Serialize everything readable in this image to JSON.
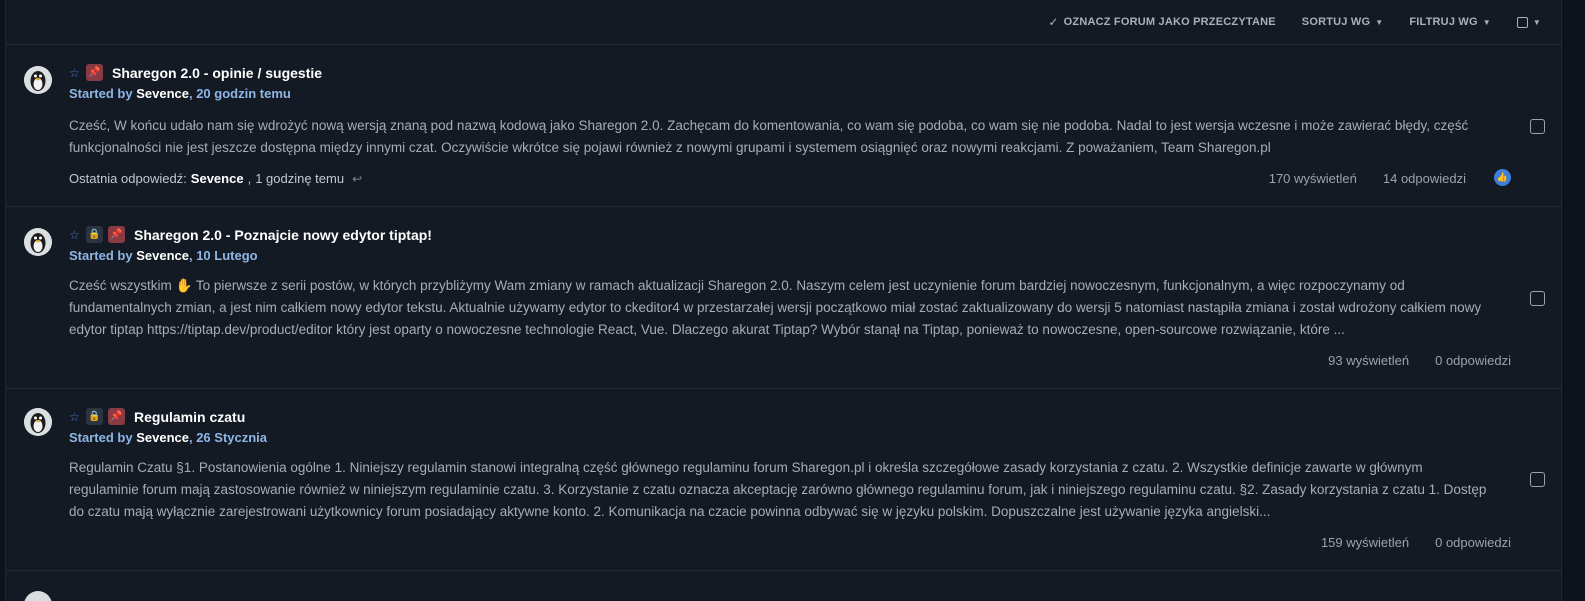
{
  "toolbar": {
    "mark_read": "OZNACZ FORUM JAKO PRZECZYTANE",
    "sort": "SORTUJ WG",
    "filter": "FILTRUJ WG"
  },
  "topics": [
    {
      "title": "Sharegon 2.0 - opinie / sugestie",
      "started_by": "Started by",
      "author": "Sevence",
      "date": "20 godzin temu",
      "snippet": "Cześć, W końcu udało nam się wdrożyć nową wersją znaną pod nazwą kodową jako Sharegon 2.0. Zachęcam do komentowania, co wam się podoba, co wam się nie podoba. Nadal to jest wersja wczesne i może zawierać błędy, część funkcjonalności nie jest jeszcze dostępna między innymi czat. Oczywiście wkrótce się pojawi również z nowymi grupami i systemem osiągnięć oraz nowymi reakcjami. Z poważaniem, Team Sharegon.pl",
      "last_reply_label": "Ostatnia odpowiedź:",
      "last_reply_author": "Sevence",
      "last_reply_time": "1 godzinę temu",
      "views": "170 wyświetleń",
      "replies": "14 odpowiedzi",
      "locked": false,
      "pinned": true
    },
    {
      "title": "Sharegon 2.0 - Poznajcie nowy edytor tiptap!",
      "started_by": "Started by",
      "author": "Sevence",
      "date": "10 Lutego",
      "snippet_pre": "Cześć wszystkim",
      "snippet_emoji": "✋",
      "snippet": "To pierwsze z serii postów, w których przybliżymy Wam zmiany w ramach aktualizacji Sharegon 2.0. Naszym celem jest uczynienie forum bardziej nowoczesnym, funkcjonalnym, a więc rozpoczynamy od fundamentalnych zmian, a jest nim całkiem nowy edytor tekstu. Aktualnie używamy edytor to ckeditor4 w przestarzałej wersji początkowo miał zostać zaktualizowany do wersji 5 natomiast nastąpiła zmiana i został wdrożony całkiem nowy edytor tiptap https://tiptap.dev/product/editor który jest oparty o nowoczesne technologie React, Vue. Dlaczego akurat Tiptap? Wybór stanął na Tiptap, ponieważ to nowoczesne, open-sourcowe rozwiązanie, które ...",
      "views": "93 wyświetleń",
      "replies": "0 odpowiedzi",
      "locked": true,
      "pinned": true
    },
    {
      "title": "Regulamin czatu",
      "started_by": "Started by",
      "author": "Sevence",
      "date": "26 Stycznia",
      "snippet": "Regulamin Czatu §1. Postanowienia ogólne 1. Niniejszy regulamin stanowi integralną część głównego regulaminu forum Sharegon.pl i określa szczegółowe zasady korzystania z czatu. 2. Wszystkie definicje zawarte w głównym regulaminie forum mają zastosowanie również w niniejszym regulaminie czatu. 3. Korzystanie z czatu oznacza akceptację zarówno głównego regulaminu forum, jak i niniejszego regulaminu czatu. §2. Zasady korzystania z czatu 1. Dostęp do czatu mają wyłącznie zarejestrowani użytkownicy forum posiadający aktywne konto. 2. Komunikacja na czacie powinna odbywać się w języku polskim. Dopuszczalne jest używanie języka angielski...",
      "views": "159 wyświetleń",
      "replies": "0 odpowiedzi",
      "locked": true,
      "pinned": true
    }
  ],
  "colors": {
    "background": "#131a23",
    "pin_badge": "#8a3a43",
    "lock_badge": "#2b3440",
    "link_blue": "#8fb6e6",
    "like_blue": "#3e7fdd"
  }
}
